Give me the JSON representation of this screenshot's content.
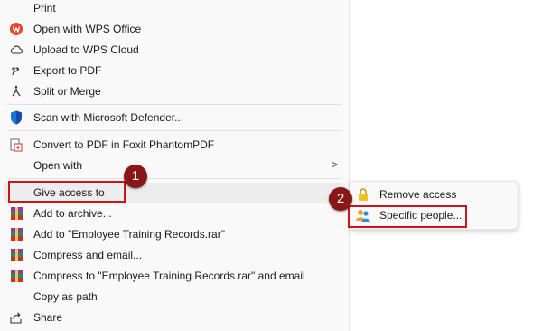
{
  "menu": {
    "items": [
      {
        "label": "Print",
        "icon": "print-icon"
      },
      {
        "label": "Open with WPS Office",
        "icon": "wps-office-icon"
      },
      {
        "label": "Upload to WPS Cloud",
        "icon": "cloud-icon"
      },
      {
        "label": "Export to PDF",
        "icon": "export-pdf-icon"
      },
      {
        "label": "Split or Merge",
        "icon": "split-merge-icon"
      },
      {
        "label": "Scan with Microsoft Defender...",
        "icon": "defender-shield-icon"
      },
      {
        "label": "Convert to PDF in Foxit PhantomPDF",
        "icon": "foxit-pdf-icon"
      },
      {
        "label": "Open with",
        "icon": "",
        "chevron": ">"
      },
      {
        "label": "Give access to",
        "icon": ""
      },
      {
        "label": "Add to archive...",
        "icon": "winrar-icon"
      },
      {
        "label": "Add to \"Employee Training Records.rar\"",
        "icon": "winrar-icon"
      },
      {
        "label": "Compress and email...",
        "icon": "winrar-icon"
      },
      {
        "label": "Compress to \"Employee Training Records.rar\" and email",
        "icon": "winrar-icon"
      },
      {
        "label": "Copy as path",
        "icon": ""
      },
      {
        "label": "Share",
        "icon": "share-icon"
      }
    ]
  },
  "submenu": {
    "items": [
      {
        "label": "Remove access",
        "icon": "lock-icon"
      },
      {
        "label": "Specific people...",
        "icon": "people-icon"
      }
    ]
  },
  "callouts": {
    "step1": "1",
    "step2": "2"
  },
  "colors": {
    "accent_red": "#c8141b",
    "badge": "#8a1717",
    "menu_bg": "#f9f9f9",
    "highlight": "#ededed"
  }
}
